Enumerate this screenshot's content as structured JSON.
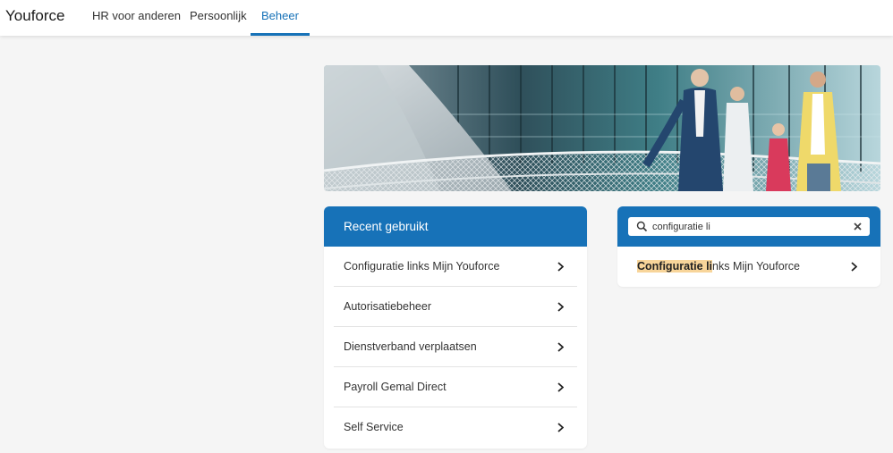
{
  "app": {
    "brand": "Youforce"
  },
  "nav": {
    "items": [
      {
        "label": "HR voor anderen",
        "active": false
      },
      {
        "label": "Persoonlijk",
        "active": false
      },
      {
        "label": "Beheer",
        "active": true
      }
    ]
  },
  "recent": {
    "title": "Recent gebruikt",
    "items": [
      {
        "label": "Configuratie links Mijn Youforce"
      },
      {
        "label": "Autorisatiebeheer"
      },
      {
        "label": "Dienstverband verplaatsen"
      },
      {
        "label": "Payroll Gemal Direct"
      },
      {
        "label": "Self Service"
      }
    ]
  },
  "search": {
    "value": "configuratie li",
    "results": [
      {
        "match": "Configuratie li",
        "rest": "nks Mijn Youforce"
      }
    ]
  },
  "colors": {
    "accent": "#1772b8",
    "highlight": "#f8d59a",
    "background": "#f5f5f5"
  },
  "icons": {
    "search": "search-icon",
    "clear": "close-icon",
    "chevron": "chevron-right-icon"
  }
}
